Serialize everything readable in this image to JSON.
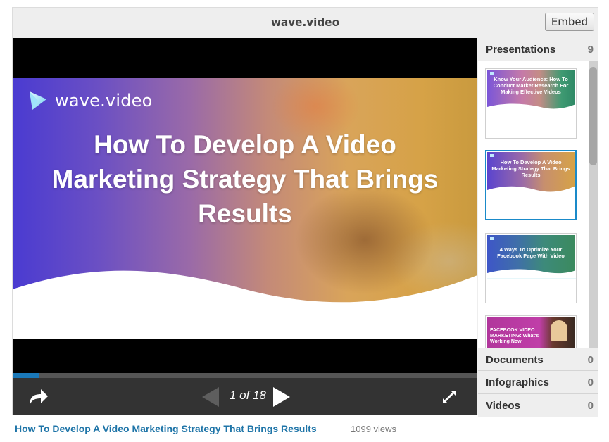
{
  "header": {
    "title": "wave.video",
    "embed_label": "Embed"
  },
  "slide": {
    "logo_text": "wave.video",
    "headline": "How To Develop A Video Marketing Strategy That Brings Results",
    "icon": "wave-video-logo-icon"
  },
  "player": {
    "current_page": 1,
    "total_pages": 18,
    "page_indicator": "1 of 18",
    "progress_fraction": 0.0556,
    "accent_color": "#1a78b8",
    "controls": {
      "share_icon": "share-arrow-icon",
      "prev_icon": "previous-triangle-icon",
      "next_icon": "next-triangle-icon",
      "fullscreen_icon": "fullscreen-expand-icon"
    }
  },
  "sidebar": {
    "categories": [
      {
        "label": "Presentations",
        "count": "9"
      },
      {
        "label": "Documents",
        "count": "0"
      },
      {
        "label": "Infographics",
        "count": "0"
      },
      {
        "label": "Videos",
        "count": "0"
      }
    ],
    "presentations": [
      {
        "caption": "Know Your Audience: How To Conduct Market Research For Making Effective Videos",
        "active": false
      },
      {
        "caption": "How To Develop A Video Marketing Strategy That Brings Results",
        "active": true
      },
      {
        "caption": "4 Ways To Optimize Your Facebook Page With Video",
        "active": false
      },
      {
        "caption": "FACEBOOK VIDEO MARKETING: What's Working Now",
        "active": false
      }
    ]
  },
  "footer": {
    "title": "How To Develop A Video Marketing Strategy That Brings Results",
    "views": "1099 views"
  }
}
